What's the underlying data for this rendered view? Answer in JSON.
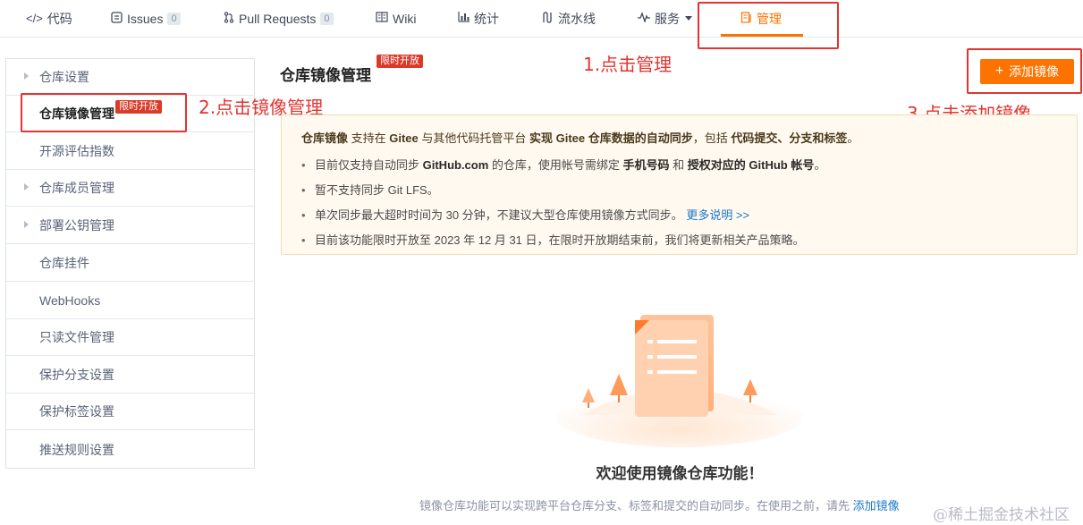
{
  "nav": {
    "code": "代码",
    "issues": "Issues",
    "issues_count": "0",
    "pulls": "Pull Requests",
    "pulls_count": "0",
    "wiki": "Wiki",
    "stats": "统计",
    "pipeline": "流水线",
    "services": "服务",
    "manage": "管理"
  },
  "sidebar": {
    "items": [
      {
        "label": "仓库设置",
        "expandable": true
      },
      {
        "label": "仓库镜像管理",
        "badge": "限时开放",
        "active": true
      },
      {
        "label": "开源评估指数"
      },
      {
        "label": "仓库成员管理",
        "expandable": true
      },
      {
        "label": "部署公钥管理",
        "expandable": true
      },
      {
        "label": "仓库挂件"
      },
      {
        "label": "WebHooks"
      },
      {
        "label": "只读文件管理"
      },
      {
        "label": "保护分支设置"
      },
      {
        "label": "保护标签设置"
      },
      {
        "label": "推送规则设置"
      }
    ]
  },
  "main": {
    "title": "仓库镜像管理",
    "title_badge": "限时开放",
    "add_button": "添加镜像",
    "notice": {
      "lead_parts": [
        "仓库镜像",
        " 支持在 ",
        "Gitee",
        " 与其他代码托管平台 ",
        "实现 Gitee 仓库数据的自动同步",
        "，包括 ",
        "代码提交、分支和标签",
        "。"
      ],
      "items": [
        {
          "parts": [
            "目前仅支持自动同步 ",
            "GitHub.com",
            " 的仓库，使用帐号需绑定 ",
            "手机号码",
            " 和 ",
            "授权对应的 GitHub 帐号",
            "。"
          ]
        },
        {
          "parts": [
            "暂不支持同步 Git LFS。"
          ]
        },
        {
          "parts": [
            "单次同步最大超时时间为 30 分钟，不建议大型仓库使用镜像方式同步。"
          ],
          "link": "更多说明 >>"
        },
        {
          "parts": [
            "目前该功能限时开放至 2023 年 12 月 31 日，在限时开放期结束前，我们将更新相关产品策略。"
          ]
        }
      ]
    },
    "welcome": "欢迎使用镜像仓库功能！",
    "desc": "镜像仓库功能可以实现跨平台仓库分支、标签和提交的自动同步。在使用之前，请先 ",
    "desc_link": "添加镜像"
  },
  "annotations": {
    "step1": "1.点击管理",
    "step2": "2.点击镜像管理",
    "step3": "3.点击添加镜像"
  },
  "watermark": "@稀土掘金技术社区",
  "colors": {
    "accent": "#fe7300",
    "annotation_red": "#e3342f",
    "badge_red": "#d93b2a",
    "notice_bg": "#fff9ef"
  }
}
